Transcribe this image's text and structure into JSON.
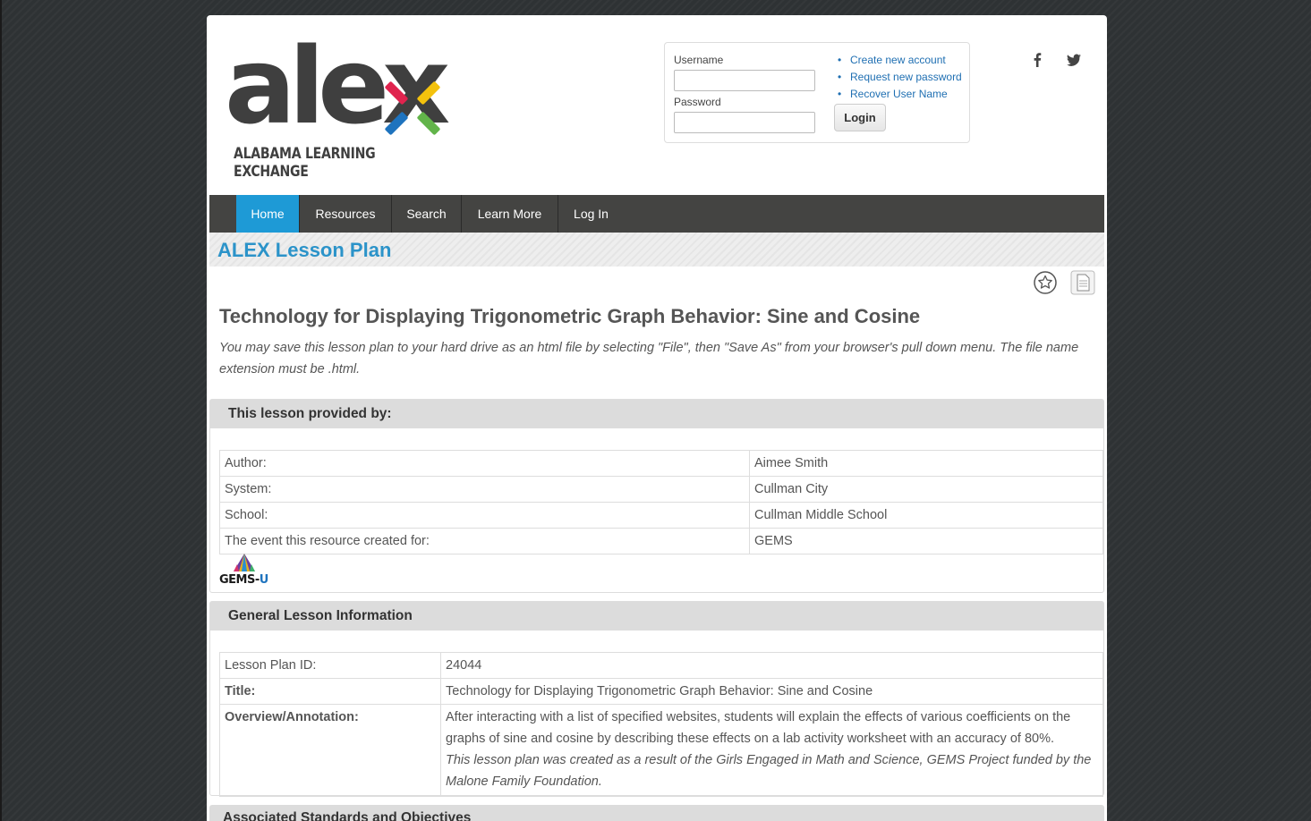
{
  "logo": {
    "word": "alex",
    "subtitle": "ALABAMA LEARNING EXCHANGE"
  },
  "login": {
    "username_label": "Username",
    "password_label": "Password",
    "username_value": "",
    "password_value": "",
    "links": [
      "Create new account",
      "Request new password",
      "Recover User Name"
    ],
    "login_button": "Login"
  },
  "social": [
    "facebook-icon",
    "twitter-icon"
  ],
  "nav": {
    "items": [
      {
        "label": "Home",
        "active": true
      },
      {
        "label": "Resources",
        "active": false
      },
      {
        "label": "Search",
        "active": false
      },
      {
        "label": "Learn More",
        "active": false
      },
      {
        "label": "Log In",
        "active": false
      }
    ]
  },
  "page": {
    "band_title": "ALEX Lesson Plan",
    "title": "Technology for Displaying Trigonometric Graph Behavior: Sine and Cosine",
    "save_note": "You may save this lesson plan to your hard drive as an html file by selecting \"File\", then \"Save As\" from your browser's pull down menu. The file name extension must be .html."
  },
  "provider": {
    "heading": "This lesson provided by:",
    "rows": [
      {
        "label": "Author:",
        "value": "Aimee Smith"
      },
      {
        "label": "System:",
        "value": "Cullman City"
      },
      {
        "label": "School:",
        "value": "Cullman Middle School"
      },
      {
        "label": "The event this resource created for:",
        "value": "GEMS"
      }
    ],
    "badge": {
      "word": "GEMS-",
      "letter": "U"
    }
  },
  "general": {
    "heading": "General Lesson Information",
    "id_label": "Lesson Plan ID:",
    "id_value": "24044",
    "title_label": "Title:",
    "title_value": "Technology for Displaying Trigonometric Graph Behavior: Sine and Cosine",
    "overview_label": "Overview/Annotation:",
    "overview_value": "After interacting with a list of specified websites, students will explain the effects of various coefficients on the graphs of sine and cosine by describing these effects on a lab activity worksheet with an accuracy of 80%.",
    "overview_note": "This lesson plan was created as a result of the Girls Engaged in Math and Science, GEMS Project funded by the Malone Family Foundation."
  },
  "next_section": {
    "heading": "Associated Standards and Objectives"
  },
  "colors": {
    "accent": "#1e9ad6",
    "nav_bg": "#444442",
    "link": "#1f6fb2",
    "title_blue": "#2b93c9"
  }
}
